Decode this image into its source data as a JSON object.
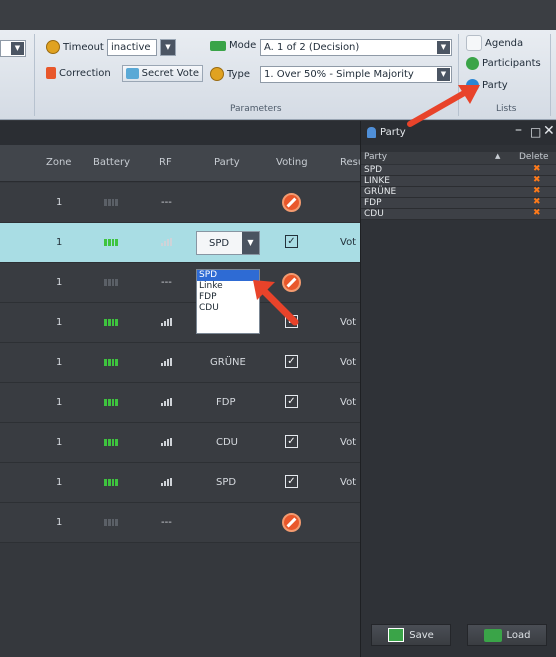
{
  "ribbon": {
    "timeout_label": "Timeout",
    "timeout_value": "inactive",
    "correction_label": "Correction",
    "secret_vote_label": "Secret Vote",
    "mode_label": "Mode",
    "mode_value": "A. 1 of 2 (Decision)",
    "type_label": "Type",
    "type_value": "1. Over 50% - Simple Majority",
    "parameters_title": "Parameters",
    "agenda_label": "Agenda",
    "participants_label": "Participants",
    "party_label": "Party",
    "lists_title": "Lists"
  },
  "table": {
    "headers": [
      "Zone",
      "Battery",
      "RF",
      "Party",
      "Voting",
      "Resu"
    ],
    "rows": [
      {
        "zone": "1",
        "battery": "empty",
        "rf": "---",
        "party": "",
        "voting": "no",
        "result": ""
      },
      {
        "zone": "1",
        "battery": "full",
        "rf": "bars",
        "party": "SPD",
        "voting": "check",
        "result": "Vot"
      },
      {
        "zone": "1",
        "battery": "empty",
        "rf": "---",
        "party": "",
        "voting": "no",
        "result": ""
      },
      {
        "zone": "1",
        "battery": "full",
        "rf": "bars",
        "party": "",
        "voting": "check",
        "result": "Vot"
      },
      {
        "zone": "1",
        "battery": "full",
        "rf": "bars",
        "party": "GRÜNE",
        "voting": "check",
        "result": "Vot"
      },
      {
        "zone": "1",
        "battery": "full",
        "rf": "bars",
        "party": "FDP",
        "voting": "check",
        "result": "Vot"
      },
      {
        "zone": "1",
        "battery": "full",
        "rf": "bars",
        "party": "CDU",
        "voting": "check",
        "result": "Vot"
      },
      {
        "zone": "1",
        "battery": "full",
        "rf": "bars",
        "party": "SPD",
        "voting": "check",
        "result": "Vot"
      },
      {
        "zone": "1",
        "battery": "empty",
        "rf": "---",
        "party": "",
        "voting": "no",
        "result": ""
      }
    ],
    "party_select_value": "SPD",
    "party_options": [
      "SPD",
      "Linke",
      "FDP",
      "CDU"
    ]
  },
  "panel": {
    "title": "Party",
    "col_party": "Party",
    "col_delete": "Delete",
    "parties": [
      "SPD",
      "LINKE",
      "GRÜNE",
      "FDP",
      "CDU"
    ],
    "save_label": "Save",
    "load_label": "Load"
  },
  "colors": {
    "accent_arrow": "#e8432a",
    "row_highlight": "#a9dde4",
    "battery_ok": "#3ec43e"
  }
}
